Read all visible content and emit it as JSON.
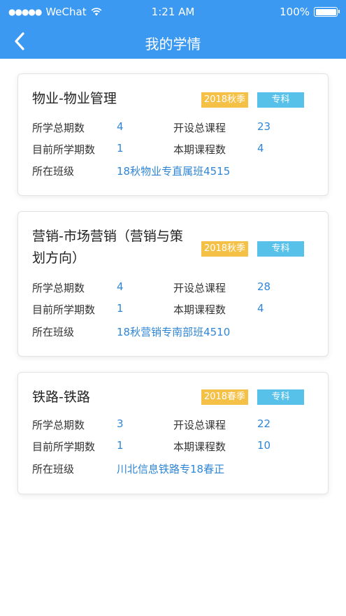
{
  "status_bar": {
    "signal": "●●●●●",
    "carrier": "WeChat",
    "time": "1:21 AM",
    "battery_percent": "100%"
  },
  "nav": {
    "title": "我的学情",
    "back_icon": "chevron-left-icon"
  },
  "labels": {
    "total_terms": "所学总期数",
    "current_term": "目前所学期数",
    "class": "所在班级",
    "total_courses": "开设总课程",
    "term_courses": "本期课程数"
  },
  "colors": {
    "header": "#3b99f2",
    "season_badge": "#f5c046",
    "level_badge": "#58c1ea",
    "value_text": "#2f86d6"
  },
  "cards": [
    {
      "title_line1": "物业-物业管理",
      "title_line2": "",
      "season": "2018秋季",
      "level": "专科",
      "total_terms": "4",
      "total_courses": "23",
      "current_term": "1",
      "term_courses": "4",
      "class": "18秋物业专直属班4515"
    },
    {
      "title_line1": "营销-市场营销（营销与策",
      "title_line2": "划方向）",
      "season": "2018秋季",
      "level": "专科",
      "total_terms": "4",
      "total_courses": "28",
      "current_term": "1",
      "term_courses": "4",
      "class": "18秋营销专南部班4510"
    },
    {
      "title_line1": "铁路-铁路",
      "title_line2": "",
      "season": "2018春季",
      "level": "专科",
      "total_terms": "3",
      "total_courses": "22",
      "current_term": "1",
      "term_courses": "10",
      "class": "川北信息铁路专18春正"
    }
  ]
}
